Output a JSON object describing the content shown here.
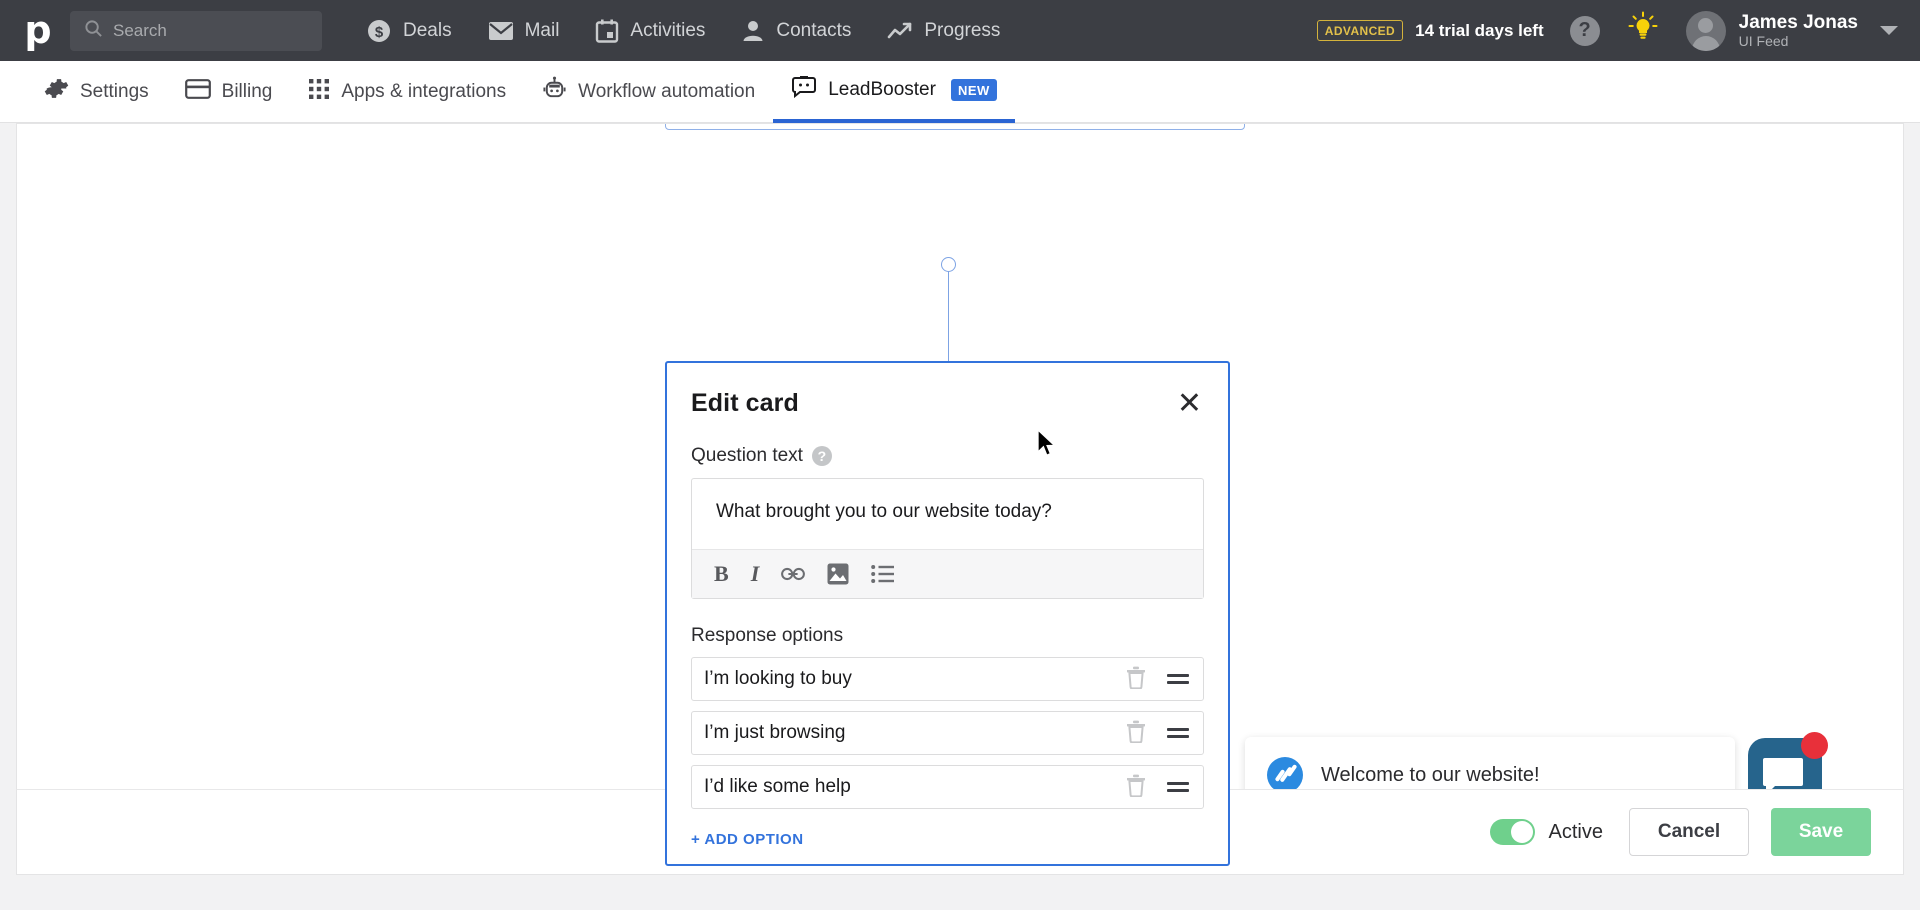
{
  "topnav": {
    "logo": "p",
    "search": {
      "placeholder": "Search",
      "icon": "search-icon"
    },
    "items": [
      {
        "label": "Deals",
        "icon": "deals-dollar-icon"
      },
      {
        "label": "Mail",
        "icon": "mail-envelope-icon"
      },
      {
        "label": "Activities",
        "icon": "activities-calendar-icon"
      },
      {
        "label": "Contacts",
        "icon": "contacts-person-icon"
      },
      {
        "label": "Progress",
        "icon": "progress-trend-icon"
      }
    ],
    "plan_badge": "ADVANCED",
    "trial_text": "14 trial days left",
    "help_icon": "question-mark-icon",
    "tips_icon": "lightbulb-icon",
    "user": {
      "name": "James Jonas",
      "subtitle": "UI Feed"
    }
  },
  "subnav": {
    "items": [
      {
        "label": "Settings",
        "icon": "gear-icon",
        "active": false
      },
      {
        "label": "Billing",
        "icon": "credit-card-icon",
        "active": false
      },
      {
        "label": "Apps & integrations",
        "icon": "grid-apps-icon",
        "active": false
      },
      {
        "label": "Workflow automation",
        "icon": "robot-icon",
        "active": false
      },
      {
        "label": "LeadBooster",
        "icon": "chatbot-icon",
        "active": true,
        "badge": "NEW"
      }
    ]
  },
  "edit_card": {
    "title": "Edit card",
    "close_icon": "close-icon",
    "question_label": "Question text",
    "question_help_icon": "help-circle-icon",
    "question_value": "What brought you to our website today?",
    "toolbar": [
      {
        "name": "bold-icon",
        "glyph": "B"
      },
      {
        "name": "italic-icon",
        "glyph": "I"
      },
      {
        "name": "link-icon",
        "glyph": "link"
      },
      {
        "name": "image-icon",
        "glyph": "image"
      },
      {
        "name": "bullet-list-icon",
        "glyph": "list"
      }
    ],
    "response_options_label": "Response options",
    "options": [
      {
        "text": "I’m looking to buy"
      },
      {
        "text": "I’m just browsing"
      },
      {
        "text": "I’d like some help"
      }
    ],
    "add_option_label": "+ ADD OPTION"
  },
  "chat_preview": {
    "message": "Welcome to our website!",
    "avatar_icon": "chat-avatar-icon",
    "launcher_icon": "chat-launcher-icon",
    "unread_badge": ""
  },
  "footer": {
    "toggle_state": "on",
    "toggle_label": "Active",
    "cancel_label": "Cancel",
    "save_label": "Save"
  },
  "colors": {
    "topbar_bg": "#3c3e44",
    "accent_blue": "#3373dc",
    "save_green": "#7bd49b",
    "toggle_green": "#6fd08c",
    "badge_yellow": "#e2c04a",
    "notification_red": "#e8303a"
  }
}
